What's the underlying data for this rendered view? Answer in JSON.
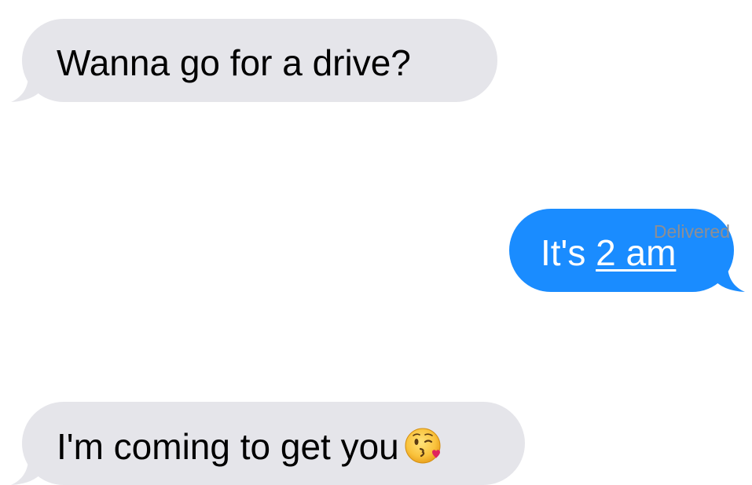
{
  "conversation": {
    "messages": [
      {
        "direction": "incoming",
        "text": "Wanna go for a drive?"
      },
      {
        "direction": "outgoing",
        "text_prefix": "It's ",
        "link_text": "2 am"
      },
      {
        "direction": "incoming",
        "text": "I'm coming to get you",
        "emoji": "face-throwing-kiss-emoji"
      }
    ],
    "status": "Delivered"
  },
  "colors": {
    "incoming_bubble": "#e5e5ea",
    "outgoing_bubble": "#1a8cff",
    "status_text": "#8e8e93"
  }
}
